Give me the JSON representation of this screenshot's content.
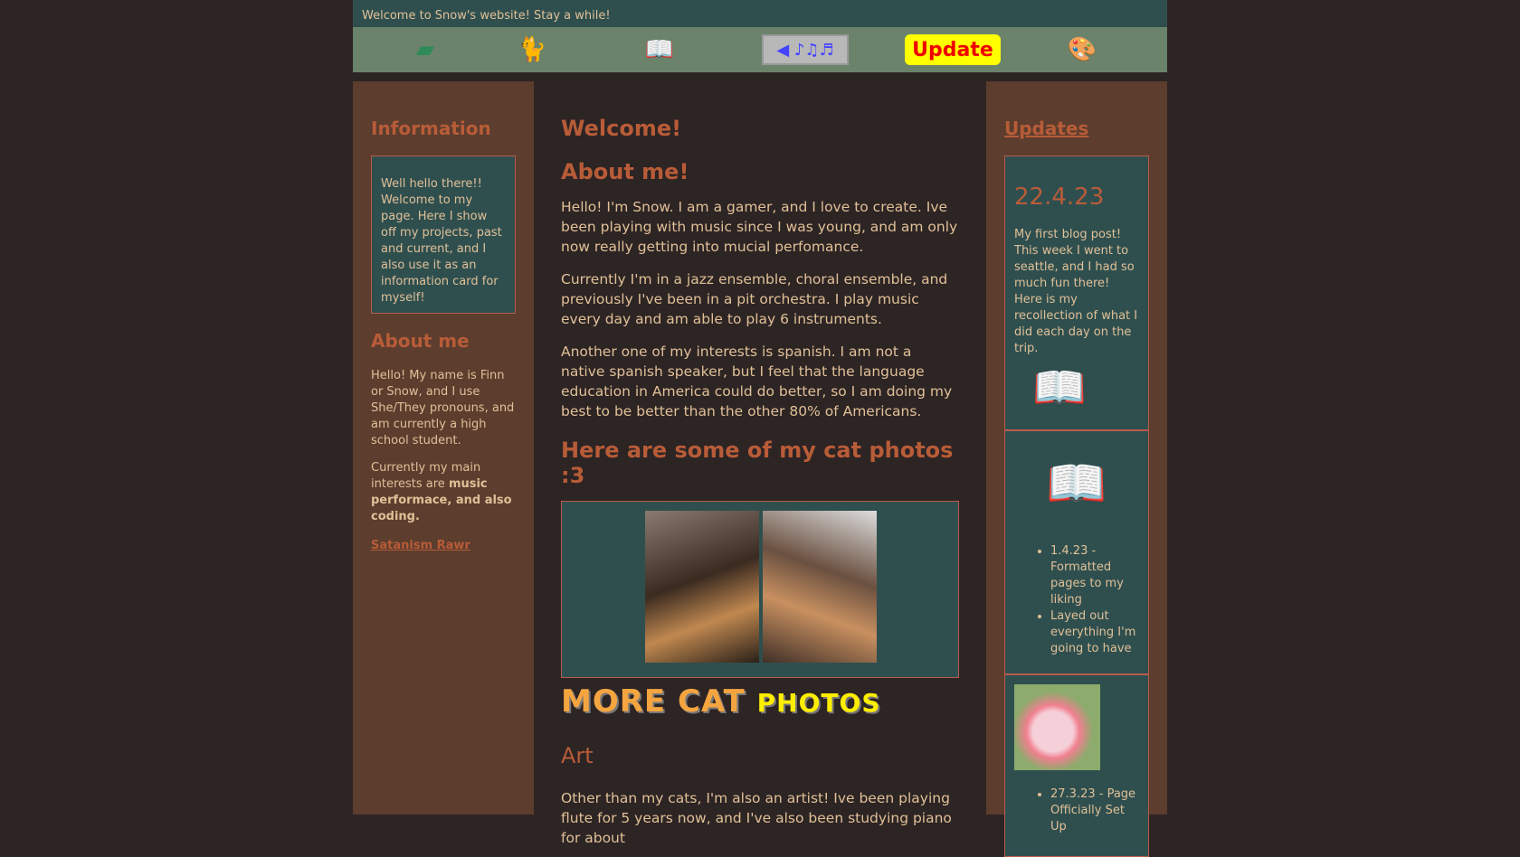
{
  "header": {
    "welcome": "Welcome to Snow's website! Stay a while!",
    "nav": [
      {
        "icon": "folder-icon"
      },
      {
        "icon": "cat-icon"
      },
      {
        "icon": "book-icon"
      },
      {
        "icon": "music-icon"
      },
      {
        "icon": "update-button",
        "label": "Update"
      },
      {
        "icon": "palette-icon"
      }
    ]
  },
  "left": {
    "info_title": "Information",
    "info_text": "Well hello there!! Welcome to my page. Here I show off my projects, past and current, and I also use it as an information card for myself!",
    "about_title": "About me",
    "about_p1": "Hello! My name is Finn or Snow, and I use She/They pronouns, and am currently a high school student.",
    "about_p2_pre": "Currently my main interests are ",
    "about_p2_bold": "music performace, and also coding.",
    "link": "Satanism Rawr"
  },
  "main": {
    "welcome": "Welcome!",
    "about_title": "About me!",
    "p1": "Hello! I'm Snow. I am a gamer, and I love to create. Ive been playing with music since I was young, and am only now really getting into mucial perfomance.",
    "p2": "Currently I'm in a jazz ensemble, choral ensemble, and previously I've been in a pit orchestra. I play music every day and am able to play 6 instruments.",
    "p3": "Another one of my interests is spanish. I am not a native spanish speaker, but I feel that the language education in America could do better, so I am doing my best to be better than the other 80% of Americans.",
    "cats_title": "Here are some of my cat photos :3",
    "more_cat": "MORE CAT",
    "more_photos": "PHOTOS",
    "art_title": "Art",
    "art_p": "Other than my cats, I'm also an artist! Ive been playing flute for 5 years now, and I've also been studying piano for about"
  },
  "right": {
    "title": "Updates",
    "post_date": "22.4.23",
    "post_text": "My first blog post! This week I went to seattle, and I had so much fun there! Here is my recollection of what I did each day on the trip.",
    "list1": [
      "1.4.23 - Formatted pages to my liking",
      "Layed out everything I'm going to have"
    ],
    "list2": [
      "27.3.23 - Page Officially Set Up"
    ]
  }
}
